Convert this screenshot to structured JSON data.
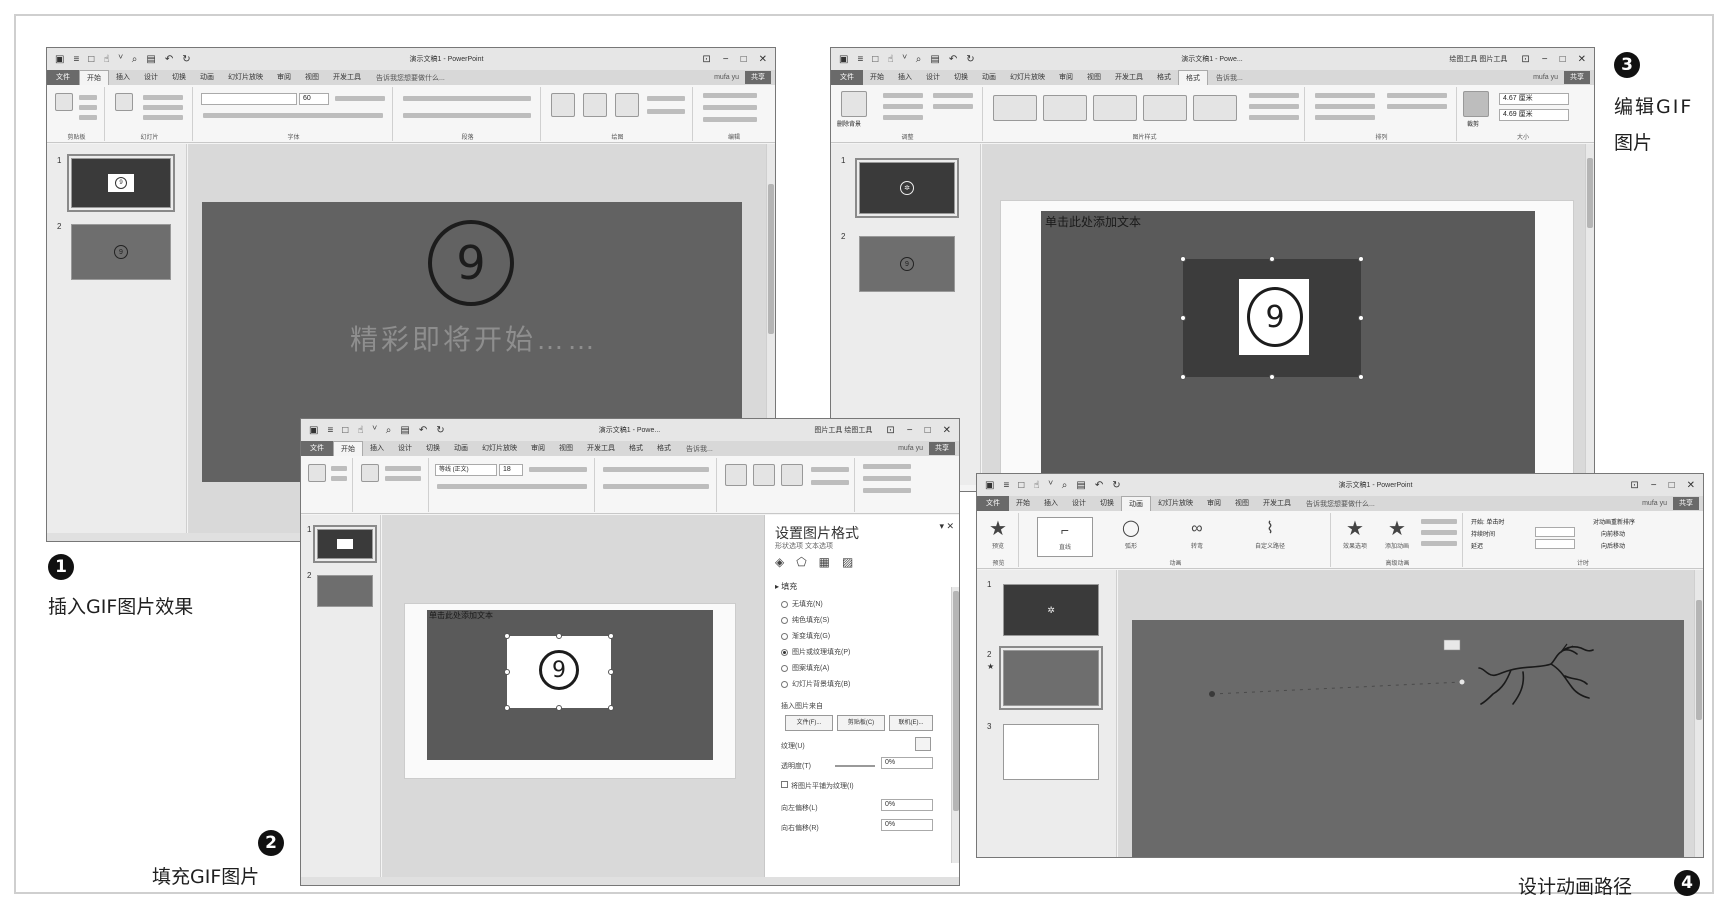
{
  "steps": [
    {
      "number": "1",
      "label": "插入GIF图片效果"
    },
    {
      "number": "2",
      "label": "填充GIF图片"
    },
    {
      "number": "3",
      "label_line1": "编辑GIF",
      "label_line2": "图片"
    },
    {
      "number": "4",
      "label": "设计动画路径"
    }
  ],
  "window1": {
    "title": "演示文稿1 - PowerPoint",
    "tabs": [
      "文件",
      "开始",
      "插入",
      "设计",
      "切换",
      "动画",
      "幻灯片放映",
      "审阅",
      "视图",
      "开发工具"
    ],
    "active_tab": "开始",
    "tell_me": "告诉我您想要做什么...",
    "user": "mufa yu",
    "share": "共享",
    "ribbon_groups": [
      "剪贴板",
      "幻灯片",
      "字体",
      "段落",
      "绘图",
      "编辑"
    ],
    "font_size": "60",
    "thumb_numbers": [
      "1",
      "2"
    ],
    "slide_number_text": "9",
    "slide_caption": "精彩即将开始……"
  },
  "window2": {
    "title": "演示文稿1 - Powe...",
    "context_tools": "图片工具 绘图工具",
    "tabs": [
      "文件",
      "开始",
      "插入",
      "设计",
      "切换",
      "动画",
      "幻灯片放映",
      "审阅",
      "视图",
      "开发工具",
      "格式",
      "格式"
    ],
    "tell_me": "告诉我...",
    "user": "mufa yu",
    "share": "共享",
    "font_name": "等线 (正文)",
    "font_size": "18",
    "thumb_numbers": [
      "1",
      "2"
    ],
    "placeholder": "单击此处添加文本",
    "gif_number": "9",
    "pane": {
      "title": "设置图片格式",
      "subtitle": "形状选项   文本选项",
      "section": "填充",
      "fill_options": [
        "无填充(N)",
        "纯色填充(S)",
        "渐变填充(G)",
        "图片或纹理填充(P)",
        "图案填充(A)",
        "幻灯片背景填充(B)"
      ],
      "selected_fill": "图片或纹理填充(P)",
      "insert_from_label": "插入图片来自",
      "buttons": [
        "文件(F)...",
        "剪贴板(C)",
        "联机(E)..."
      ],
      "texture_label": "纹理(U)",
      "transparency_label": "透明度(T)",
      "transparency_value": "0%",
      "tile_label": "将图片平铺为纹理(I)",
      "offset_left_label": "向左偏移(L)",
      "offset_left_value": "0%",
      "offset_right_label": "向右偏移(R)",
      "offset_right_value": "0%"
    }
  },
  "window3": {
    "title": "演示文稿1 - Powe...",
    "context_tools": "绘图工具 图片工具",
    "tabs": [
      "文件",
      "开始",
      "插入",
      "设计",
      "切换",
      "动画",
      "幻灯片放映",
      "审阅",
      "视图",
      "开发工具",
      "格式",
      "格式"
    ],
    "tell_me": "告诉我...",
    "user": "mufa yu",
    "share": "共享",
    "ribbon_groups": [
      "调整",
      "图片样式",
      "排列",
      "大小"
    ],
    "remove_bg": "删除背景",
    "height_value": "4.67 厘米",
    "width_value": "4.69 厘米",
    "crop_label": "裁剪",
    "thumb_numbers": [
      "1",
      "2"
    ],
    "placeholder": "单击此处添加文本",
    "gif_number": "9"
  },
  "window4": {
    "title": "演示文稿1 - PowerPoint",
    "tabs": [
      "文件",
      "开始",
      "插入",
      "设计",
      "切换",
      "动画",
      "幻灯片放映",
      "审阅",
      "视图",
      "开发工具"
    ],
    "active_tab": "动画",
    "tell_me": "告诉我您想要做什么...",
    "user": "mufa yu",
    "share": "共享",
    "animations": [
      "直线",
      "弧形",
      "转弯",
      "自定义路径"
    ],
    "ribbon_groups": [
      "预览",
      "动画",
      "高级动画",
      "计时"
    ],
    "preview_label": "预览",
    "effect_options": "效果选项",
    "add_animation": "添加动画",
    "start_label": "开始: 单击时",
    "duration_label": "持续时间",
    "delay_label": "延迟",
    "reorder_label": "对动画重新排序",
    "move_earlier": "向前移动",
    "move_later": "向后移动",
    "thumb_numbers": [
      "1",
      "2",
      "3"
    ]
  }
}
